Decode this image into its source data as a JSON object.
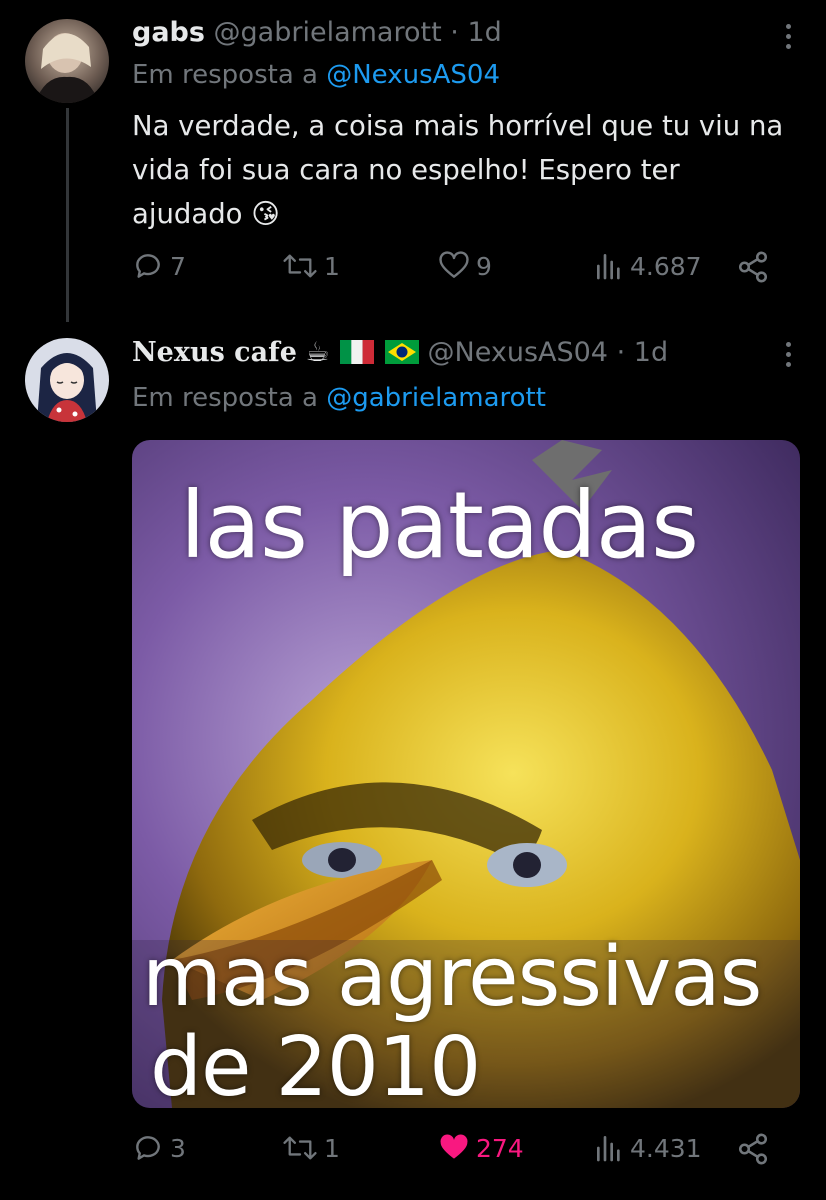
{
  "tweets": [
    {
      "name": "gabs",
      "handle": "@gabrielamarott",
      "dot": "·",
      "time": "1d",
      "reply_prefix": "Em resposta a ",
      "reply_to": "@NexusAS04",
      "text": "Na verdade, a coisa mais horrível que tu viu na vida foi sua cara no espelho!  Espero ter ajudado",
      "emoji": "😘",
      "replies": "7",
      "retweets": "1",
      "likes": "9",
      "views": "4.687"
    },
    {
      "name": "Nexus cafe",
      "name_emoji": "☕",
      "handle": "@NexusAS04",
      "dot": "·",
      "time": "1d",
      "reply_prefix": "Em resposta a ",
      "reply_to": "@gabrielamarott",
      "image": {
        "top_text": "las patadas",
        "bottom_text_1": "mas agressivas",
        "bottom_text_2": "de 2010"
      },
      "replies": "3",
      "retweets": "1",
      "likes": "274",
      "views": "4.431"
    }
  ],
  "colors": {
    "background": "#000000",
    "text": "#e7e9ea",
    "muted": "#71767b",
    "link": "#1d9bf0",
    "like_active": "#f91880",
    "thread_line": "#333639"
  },
  "icons": [
    "reply-icon",
    "retweet-icon",
    "like-icon",
    "views-icon",
    "share-icon",
    "more-icon"
  ]
}
